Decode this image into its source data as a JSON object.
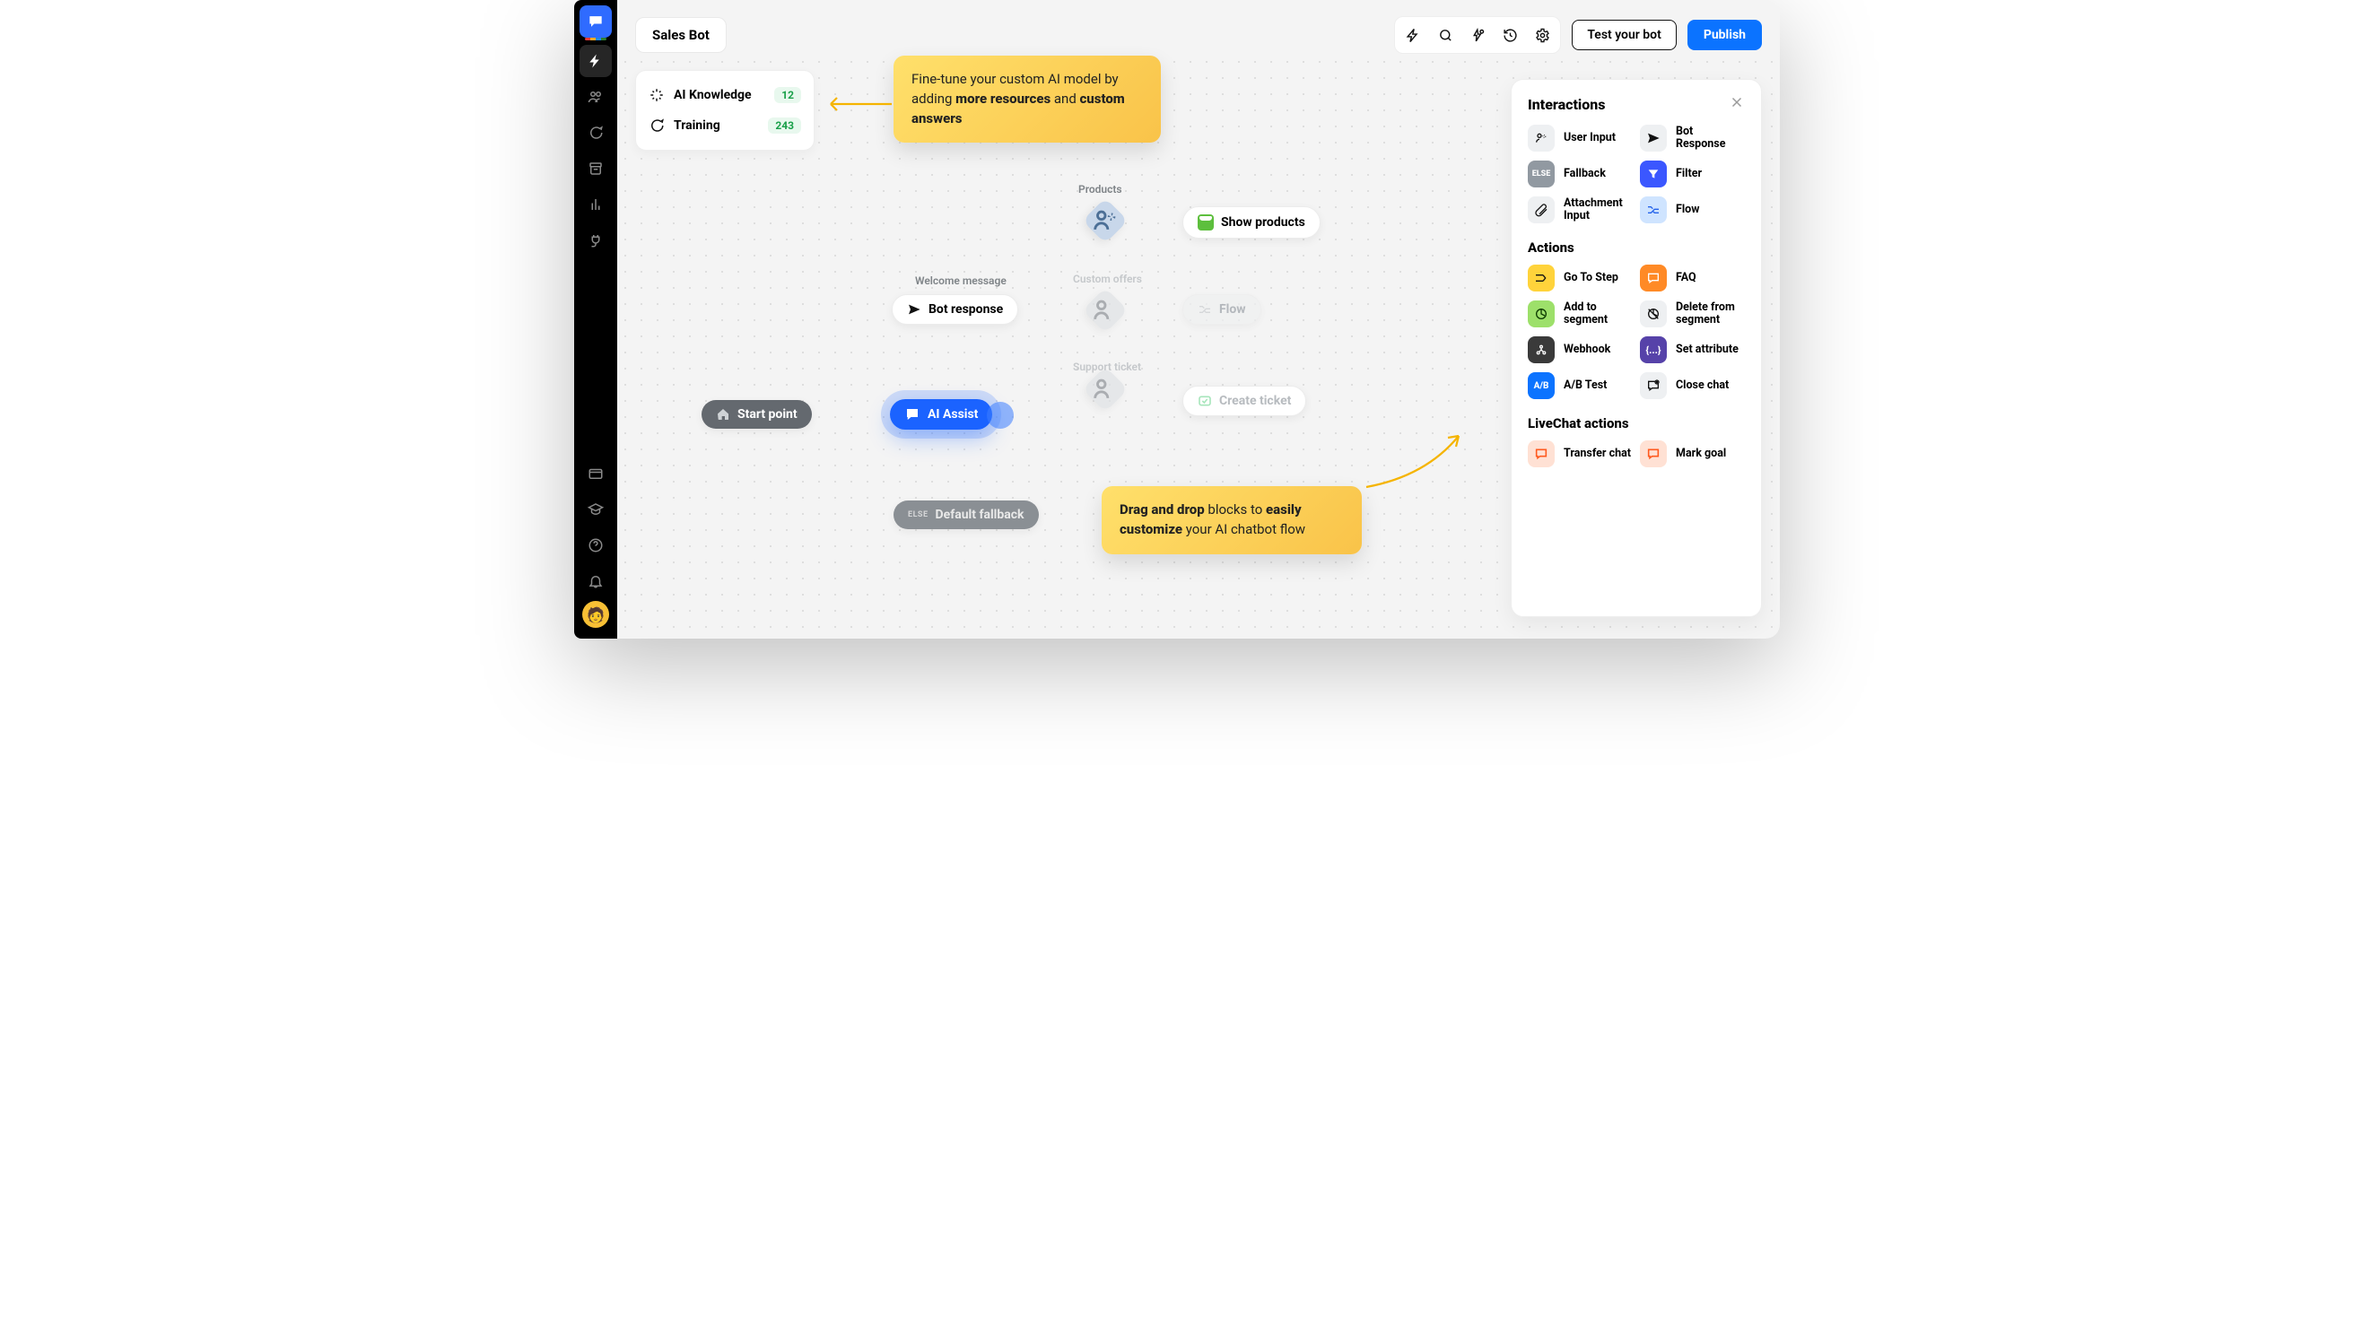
{
  "bot": {
    "name": "Sales Bot"
  },
  "topbar": {
    "test": "Test your bot",
    "publish": "Publish"
  },
  "knowledge": {
    "ai": {
      "label": "AI Knowledge",
      "count": "12"
    },
    "training": {
      "label": "Training",
      "count": "243"
    }
  },
  "callouts": {
    "tune_pre": "Fine-tune your custom AI model by adding ",
    "tune_bold1": "more resources",
    "tune_mid": " and ",
    "tune_bold2": "custom answers",
    "drop_pre": "Drag and drop",
    "drop_mid1": " blocks to ",
    "drop_bold1": "easily customize",
    "drop_mid2": " your AI chatbot flow"
  },
  "flow": {
    "start": "Start point",
    "welcome_tag": "Welcome message",
    "bot_response": "Bot response",
    "ai_assist": "AI Assist",
    "default_fallback": "Default fallback",
    "products_tag": "Products",
    "show_products": "Show products",
    "custom_tag": "Custom offers",
    "flow_chip": "Flow",
    "support_tag": "Support ticket",
    "create_ticket": "Create ticket"
  },
  "panel": {
    "title": "Interactions",
    "actions_title": "Actions",
    "lc_title": "LiveChat actions",
    "interactions": {
      "user_input": "User Input",
      "bot_response": "Bot Response",
      "fallback": "Fallback",
      "filter": "Filter",
      "attach": "Attachment Input",
      "flow": "Flow"
    },
    "actions": {
      "goto": "Go To Step",
      "faq": "FAQ",
      "add_seg": "Add to segment",
      "del_seg": "Delete from segment",
      "webhook": "Webhook",
      "set_attr": "Set attribute",
      "ab": "A/B Test",
      "close": "Close chat"
    },
    "lc": {
      "transfer": "Transfer chat",
      "goal": "Mark goal"
    }
  }
}
